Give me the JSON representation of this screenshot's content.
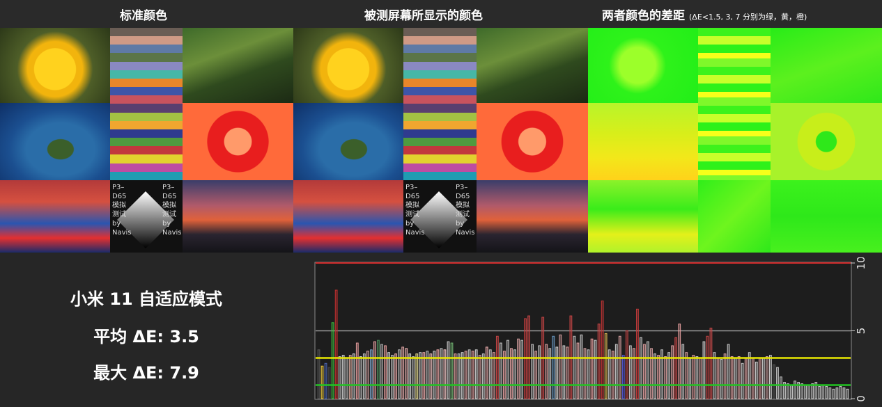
{
  "header": {
    "left_title": "标准颜色",
    "middle_title": "被测屏幕所显示的颜色",
    "right_title": "两者颜色的差距",
    "right_note": "(ΔE<1.5, 3, 7 分别为绿，黄，橙)"
  },
  "test_pattern": {
    "line1": "P3–",
    "line2": "D65",
    "line3": "模拟",
    "line4": "测试",
    "line5": "by",
    "line6": "Navis"
  },
  "summary": {
    "device": "小米 11 自适应模式",
    "avg_label": "平均 ΔE: 3.5",
    "max_label": "最大 ΔE: 7.9"
  },
  "palette": {
    "background": "#262626",
    "accent_red": "#d12b2b",
    "threshold_yellow": "#e8e800",
    "threshold_green": "#22c322",
    "stripes": [
      "#6a5d55",
      "#cf9a86",
      "#5f7aa6",
      "#5b7548",
      "#8a89c2",
      "#46b7a7",
      "#e9862a",
      "#3f55a8",
      "#c9535e",
      "#5a3f6f",
      "#a3c143",
      "#f0a62f",
      "#2f3b8f",
      "#4f9a3f",
      "#c2373d",
      "#e2d12e",
      "#bd4ca2",
      "#1f9cb2"
    ]
  },
  "chart_data": {
    "type": "bar",
    "title": "",
    "xlabel": "",
    "ylabel": "",
    "ylim": [
      0,
      10
    ],
    "yticks": [
      0,
      5,
      10
    ],
    "grid_lines": [
      5,
      10
    ],
    "thresholds": [
      {
        "value": 3,
        "color": "#e8e800"
      },
      {
        "value": 1,
        "color": "#22c322"
      }
    ],
    "values": [
      3.6,
      2.4,
      2.6,
      2.3,
      5.6,
      8.0,
      3.1,
      3.2,
      3.0,
      3.2,
      3.3,
      4.1,
      3.1,
      3.3,
      3.5,
      3.6,
      4.2,
      4.3,
      4.0,
      3.9,
      3.4,
      3.2,
      3.3,
      3.6,
      3.8,
      3.7,
      3.3,
      3.1,
      3.3,
      3.4,
      3.4,
      3.5,
      3.3,
      3.5,
      3.6,
      3.7,
      3.6,
      4.2,
      4.1,
      3.3,
      3.3,
      3.4,
      3.5,
      3.6,
      3.5,
      3.6,
      3.2,
      3.3,
      3.8,
      3.6,
      3.4,
      4.6,
      4.1,
      3.5,
      4.3,
      3.7,
      3.6,
      4.4,
      4.3,
      5.9,
      6.1,
      4.0,
      3.5,
      3.9,
      6.0,
      4.0,
      3.7,
      4.6,
      3.8,
      4.7,
      3.9,
      3.8,
      6.1,
      4.6,
      4.1,
      4.7,
      3.7,
      3.6,
      4.4,
      4.3,
      5.5,
      7.2,
      4.8,
      3.6,
      3.5,
      4.0,
      4.6,
      3.2,
      5.0,
      3.9,
      3.7,
      6.6,
      4.5,
      4.0,
      4.2,
      3.7,
      3.3,
      3.2,
      3.6,
      3.1,
      3.4,
      3.9,
      4.5,
      5.5,
      4.0,
      3.4,
      3.0,
      3.2,
      3.1,
      3.0,
      4.2,
      4.6,
      5.2,
      3.4,
      3.0,
      2.9,
      3.3,
      4.0,
      3.1,
      3.0,
      3.1,
      2.6,
      3.0,
      3.4,
      3.0,
      2.7,
      3.0,
      3.0,
      3.1,
      3.2,
      2.5,
      2.3,
      1.6,
      1.2,
      1.1,
      1.0,
      1.3,
      1.2,
      1.1,
      1.0,
      1.0,
      1.1,
      1.2,
      0.9,
      1.0,
      0.9,
      0.8,
      0.7,
      0.8,
      0.9,
      0.8,
      0.7
    ],
    "colors": [
      "#555555",
      "#e6c23a",
      "#4a64b0",
      "#444444",
      "#3cc03c",
      "#c43030",
      "#bdbdbd",
      "#cfcfcf",
      "#bbbbbb",
      "#d8a79b",
      "#cfcfcf",
      "#e59c9c",
      "#cccccc",
      "#bfbfbf",
      "#d1a0a0",
      "#7aa0c4",
      "#e6a0a0",
      "#4c8c5c",
      "#b0b0b0",
      "#e8a0a0",
      "#d0d0d0",
      "#c3c3c3",
      "#e6a7a7",
      "#bdbdbd",
      "#d7a0a0",
      "#efb5b5",
      "#cccccc",
      "#bbbbbb",
      "#d9cf8a",
      "#cfcfcf",
      "#e6a7a7",
      "#bbbbbb",
      "#dfb3b3",
      "#cccccc",
      "#e2a0a0",
      "#c0c0c0",
      "#efc2c2",
      "#c8c8c8",
      "#6fb06f",
      "#dfa0a0",
      "#c0c0c0",
      "#d1d1d1",
      "#dca0a0",
      "#bcbcbc",
      "#e5a0a0",
      "#cfcfcf",
      "#d9a0a0",
      "#c4c4c4",
      "#f0b0b0",
      "#bebebe",
      "#dfa3a3",
      "#c64545",
      "#c9c9c9",
      "#dfa0a0",
      "#c2c2c2",
      "#e5a5a5",
      "#c8c8c8",
      "#d6a0a0",
      "#c0c0c0",
      "#c53f3f",
      "#c64545",
      "#bdbdbd",
      "#d8a0a0",
      "#c7c7c7",
      "#c64545",
      "#e0a0a0",
      "#bfbfbf",
      "#6a9ac4",
      "#d0d0d0",
      "#d7a0a0",
      "#cbcbcb",
      "#dfa0a0",
      "#c74545",
      "#bebebe",
      "#e0a7a7",
      "#c8c8c8",
      "#d0a0a0",
      "#c2c2c2",
      "#e8a0a0",
      "#c9c9c9",
      "#c54545",
      "#c43535",
      "#d8b14f",
      "#c0c0c0",
      "#e0a0a0",
      "#c6c6c6",
      "#d7a0a0",
      "#5555cc",
      "#c64545",
      "#c2c2c2",
      "#e5a7a7",
      "#c43b3b",
      "#c9c9c9",
      "#dfa0a0",
      "#c3c3c3",
      "#d4a0a0",
      "#c9c9c9",
      "#e0a0a0",
      "#c0c0c0",
      "#d8a0a0",
      "#c6c6c6",
      "#e5a5a5",
      "#c84848",
      "#e8a0a0",
      "#c0c0c0",
      "#d9a0a0",
      "#cbcbcb",
      "#e2a0a0",
      "#bdbdbd",
      "#d8a0a0",
      "#c8c8c8",
      "#c64545",
      "#c54848",
      "#c2c2c2",
      "#dfa0a0",
      "#c8c8c8",
      "#d1a0a0",
      "#c2c2c2",
      "#e0a0a0",
      "#c6c6c6",
      "#d6a0a0",
      "#bfbfbf",
      "#e5a5a5",
      "#c2c2c2",
      "#d9a0a0",
      "#cbcbcb",
      "#dfa0a0",
      "#c0c0c0",
      "#d0a0a0",
      "#c8c8c8",
      "#555555",
      "#c4c4c4",
      "#bdbdbd",
      "#c6c6c6",
      "#bfbfbf",
      "#cacaca",
      "#c2c2c2",
      "#c9c9c9",
      "#bebebe",
      "#c6c6c6",
      "#bfbfbf",
      "#c9c9c9",
      "#c2c2c2",
      "#c6c6c6",
      "#bdbdbd",
      "#c8c8c8",
      "#c2c2c2",
      "#bfbfbf",
      "#cacaca",
      "#c4c4c4"
    ]
  }
}
